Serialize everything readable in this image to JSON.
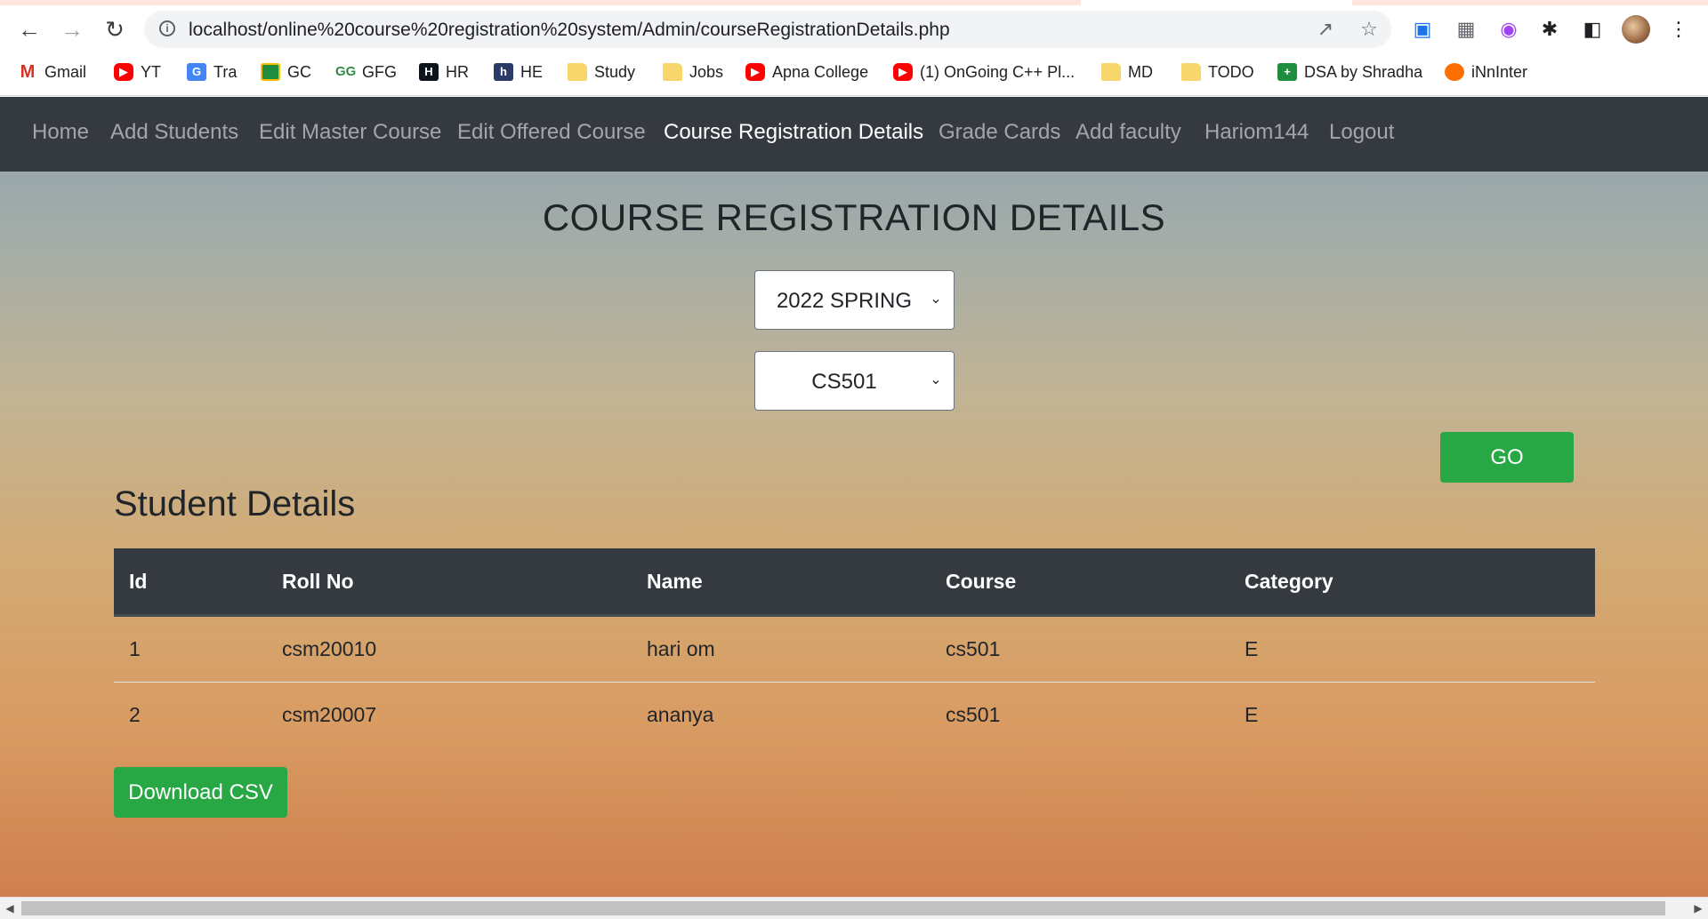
{
  "browser": {
    "url": "localhost/online%20course%20registration%20system/Admin/courseRegistrationDetails.php",
    "bookmarks": [
      {
        "label": "Gmail",
        "icon": "gmail-icon"
      },
      {
        "label": "YT",
        "icon": "youtube-icon"
      },
      {
        "label": "Tra",
        "icon": "translate-icon"
      },
      {
        "label": "GC",
        "icon": "classroom-icon"
      },
      {
        "label": "GFG",
        "icon": "gfg-icon"
      },
      {
        "label": "HR",
        "icon": "hackerrank-icon"
      },
      {
        "label": "HE",
        "icon": "hackerearth-icon"
      },
      {
        "label": "Study",
        "icon": "folder-icon"
      },
      {
        "label": "Jobs",
        "icon": "folder-icon"
      },
      {
        "label": "Apna College",
        "icon": "youtube-icon"
      },
      {
        "label": "(1) OnGoing C++ Pl...",
        "icon": "youtube-icon"
      },
      {
        "label": "MD",
        "icon": "folder-icon"
      },
      {
        "label": "TODO",
        "icon": "folder-icon"
      },
      {
        "label": "DSA by Shradha",
        "icon": "sheets-icon"
      },
      {
        "label": "iNnInter",
        "icon": "innovation-icon"
      }
    ]
  },
  "nav": {
    "items": [
      "Home",
      "Add Students",
      "Edit Master Course",
      "Edit Offered Course",
      "Course Registration Details",
      "Grade Cards",
      "Add faculty",
      "Hariom144",
      "Logout"
    ],
    "active_index": 4
  },
  "page": {
    "heading": "COURSE REGISTRATION DETAILS",
    "session_select": "2022 SPRING",
    "course_select": "CS501",
    "go_label": "GO",
    "section_title": "Student Details",
    "download_label": "Download CSV"
  },
  "table": {
    "headers": [
      "Id",
      "Roll No",
      "Name",
      "Course",
      "Category"
    ],
    "rows": [
      [
        "1",
        "csm20010",
        "hari om",
        "cs501",
        "E"
      ],
      [
        "2",
        "csm20007",
        "ananya",
        "cs501",
        "E"
      ]
    ]
  },
  "colors": {
    "navbar": "#343a40",
    "success": "#28a745"
  }
}
